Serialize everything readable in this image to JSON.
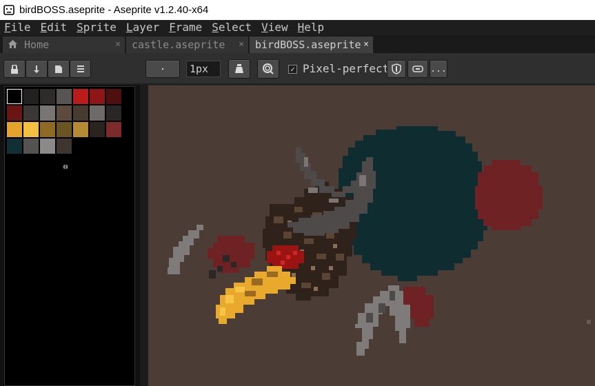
{
  "window": {
    "title": "birdBOSS.aseprite - Aseprite v1.2.40-x64"
  },
  "menu": [
    {
      "first": "F",
      "rest": "ile"
    },
    {
      "first": "E",
      "rest": "dit"
    },
    {
      "first": "S",
      "rest": "prite"
    },
    {
      "first": "L",
      "rest": "ayer"
    },
    {
      "first": "F",
      "rest": "rame"
    },
    {
      "first": "S",
      "rest": "elect"
    },
    {
      "first": "V",
      "rest": "iew"
    },
    {
      "first": "H",
      "rest": "elp"
    }
  ],
  "tabs": [
    {
      "label": "Home",
      "icon": "home-icon",
      "close": "×"
    },
    {
      "label": "castle.aseprite",
      "close": "×"
    },
    {
      "label": "birdBOSS.aseprite",
      "close": "×"
    }
  ],
  "toolbar": {
    "brush_size": "1px",
    "pixel_perfect_checked": "✓",
    "pixel_perfect_label": "Pixel-perfect",
    "more_label": "..."
  },
  "palette": {
    "colors": [
      "#000000",
      "#222020",
      "#2e2b2b",
      "#585454",
      "#bb1b1b",
      "#8e1616",
      "#4e0f0f",
      "#6b1414",
      "#3b3737",
      "#7a7575",
      "#5c4a3c",
      "#473a2e",
      "#6e6a68",
      "#2a2626",
      "#e4a32a",
      "#f3c042",
      "#8f6a25",
      "#6a5522",
      "#b58a35",
      "#2b231d",
      "#7d2a2a",
      "#103035",
      "#555252",
      "#8b8989",
      "#3e3430"
    ],
    "icons": [
      "lock-icon",
      "arrow-down-icon",
      "page-icon",
      "list-icon"
    ]
  },
  "canvas": {
    "background": "#4b3c36"
  }
}
